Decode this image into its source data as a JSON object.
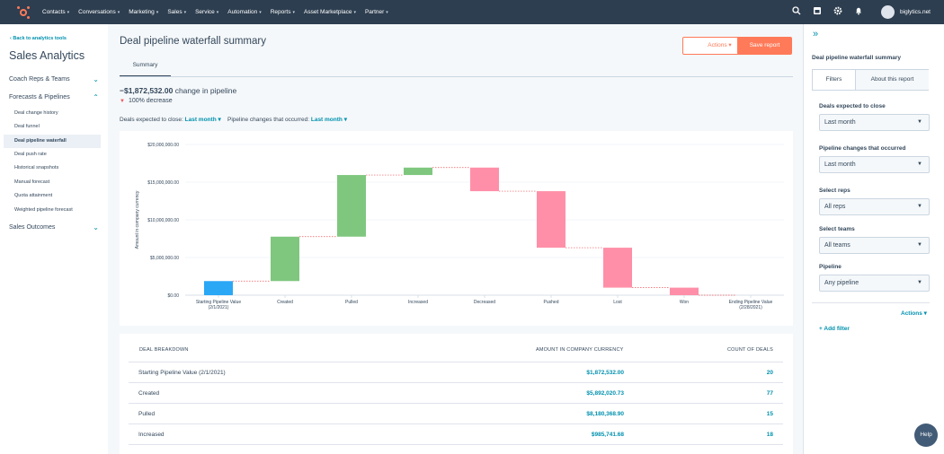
{
  "topnav": {
    "items": [
      "Contacts",
      "Conversations",
      "Marketing",
      "Sales",
      "Service",
      "Automation",
      "Reports",
      "Asset Marketplace",
      "Partner"
    ],
    "account": "biglytics.net"
  },
  "leftnav": {
    "back": "Back to analytics tools",
    "title": "Sales Analytics",
    "sections": [
      "Coach Reps & Teams",
      "Forecasts & Pipelines",
      "Sales Outcomes"
    ],
    "subitems": [
      "Deal change history",
      "Deal funnel",
      "Deal pipeline waterfall",
      "Deal push rate",
      "Historical snapshots",
      "Manual forecast",
      "Quota attainment",
      "Weighted pipeline forecast"
    ]
  },
  "main": {
    "title": "Deal pipeline waterfall summary",
    "actions_label": "Actions",
    "save_label": "Save report",
    "tab": "Summary",
    "change_value": "−$1,872,532.00",
    "change_text": "change in pipeline",
    "decrease_text": "100% decrease",
    "filter1_label": "Deals expected to close:",
    "filter1_value": "Last month",
    "filter2_label": "Pipeline changes that occurred:",
    "filter2_value": "Last month"
  },
  "chart_data": {
    "type": "waterfall",
    "ylabel": "Amount in company currency",
    "ylim": [
      0,
      20000000
    ],
    "yticks": [
      "$0.00",
      "$5,000,000.00",
      "$10,000,000.00",
      "$15,000,000.00",
      "$20,000,000.00"
    ],
    "ytick_values": [
      0,
      5000000,
      10000000,
      15000000,
      20000000
    ],
    "categories": [
      "Starting Pipeline Value (2/1/2021)",
      "Created",
      "Pulled",
      "Increased",
      "Decreased",
      "Pushed",
      "Lost",
      "Won",
      "Ending Pipeline Value (2/28/2021)"
    ],
    "bars": [
      {
        "start": 0,
        "end": 1872532,
        "kind": "total"
      },
      {
        "start": 1872532,
        "end": 7764553,
        "kind": "up"
      },
      {
        "start": 7764553,
        "end": 15944921,
        "kind": "up"
      },
      {
        "start": 15944921,
        "end": 16930663,
        "kind": "up"
      },
      {
        "start": 16930663,
        "end": 13800000,
        "kind": "down"
      },
      {
        "start": 13800000,
        "end": 6300000,
        "kind": "down"
      },
      {
        "start": 6300000,
        "end": 1000000,
        "kind": "down"
      },
      {
        "start": 1000000,
        "end": 0,
        "kind": "down"
      },
      {
        "start": 0,
        "end": 0,
        "kind": "total"
      }
    ],
    "colors": {
      "total": "#2aa7f5",
      "up": "#7fc77f",
      "down": "#ff8fa8"
    }
  },
  "table": {
    "headers": [
      "DEAL BREAKDOWN",
      "AMOUNT IN COMPANY CURRENCY",
      "COUNT OF DEALS"
    ],
    "rows": [
      {
        "label": "Starting Pipeline Value (2/1/2021)",
        "amount": "$1,872,532.00",
        "count": "20"
      },
      {
        "label": "Created",
        "amount": "$5,892,020.73",
        "count": "77"
      },
      {
        "label": "Pulled",
        "amount": "$8,180,368.90",
        "count": "15"
      },
      {
        "label": "Increased",
        "amount": "$985,741.68",
        "count": "18"
      }
    ]
  },
  "rightpanel": {
    "title": "Deal pipeline waterfall summary",
    "tab_filters": "Filters",
    "tab_about": "About this report",
    "filters": [
      {
        "label": "Deals expected to close",
        "value": "Last month"
      },
      {
        "label": "Pipeline changes that occurred",
        "value": "Last month"
      },
      {
        "label": "Select reps",
        "value": "All reps"
      },
      {
        "label": "Select teams",
        "value": "All teams"
      },
      {
        "label": "Pipeline",
        "value": "Any pipeline"
      }
    ],
    "actions": "Actions",
    "add_filter": "Add filter"
  },
  "help": "Help"
}
